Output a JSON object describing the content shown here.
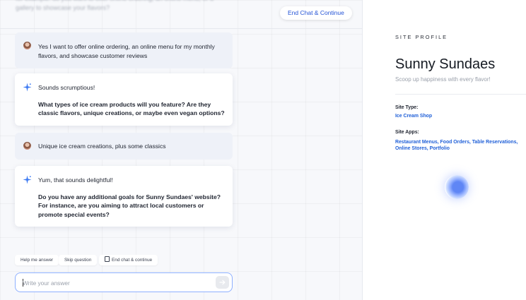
{
  "header": {
    "faded_text": "for example: do you want to offer online ordering, an online menu, or a gallery to showcase your flavors?",
    "end_chat_label": "End Chat & Continue"
  },
  "messages": [
    {
      "role": "user",
      "text": "Yes I want to offer online ordering, an online menu for my monthly flavors, and showcase customer reviews"
    },
    {
      "role": "ai",
      "intro": "Sounds scrumptious!",
      "question": "What types of ice cream products will you feature? Are they classic flavors, unique creations, or maybe even vegan options?"
    },
    {
      "role": "user",
      "text": "Unique ice cream creations, plus some classics"
    },
    {
      "role": "ai",
      "intro": "Yum, that sounds delightful!",
      "question": "Do you have any additional goals for Sunny Sundaes' website? For instance, are you aiming to attract local customers or promote special events?"
    }
  ],
  "suggestions": {
    "help": "Help me answer",
    "skip": "Skip question",
    "end": "End chat & continue"
  },
  "answer": {
    "placeholder": "Write your answer",
    "value": ""
  },
  "profile": {
    "section_label": "SITE PROFILE",
    "site_name": "Sunny Sundaes",
    "tagline": "Scoop up happiness with every flavor!",
    "site_type_label": "Site Type:",
    "site_type_value": "Ice Cream Shop",
    "site_apps_label": "Site Apps:",
    "site_apps_value": "Restaurant Menus, Food Orders, Table Reservations, Online Stores, Portfolio"
  },
  "icons": [
    "user-avatar",
    "sparkle-icon",
    "document-icon",
    "send-arrow-icon",
    "loading-orb"
  ],
  "colors": {
    "accent": "#2453d6",
    "link_blue": "#2060d8",
    "input_border": "#8eb0ff",
    "sparkle": "#3a78f2"
  }
}
